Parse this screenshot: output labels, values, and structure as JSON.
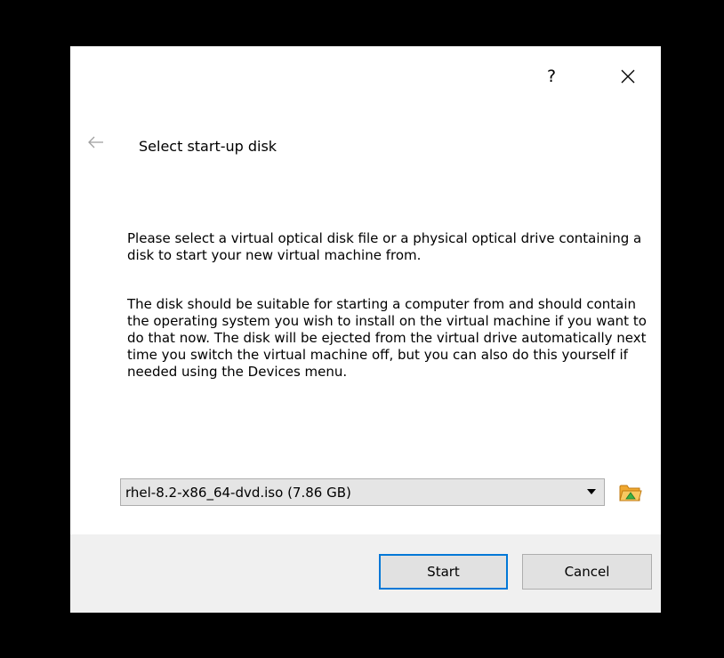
{
  "dialog": {
    "help_label": "?",
    "page_title": "Select start-up disk",
    "description_1": "Please select a virtual optical disk file or a physical optical drive containing a disk to start your new virtual machine from.",
    "description_2": "The disk should be suitable for starting a computer from and should contain the operating system you wish to install on the virtual machine if you want to do that now. The disk will be ejected from the virtual drive automatically next time you switch the virtual machine off, but you can also do this yourself if needed using the Devices menu.",
    "disk_select": {
      "selected": "rhel-8.2-x86_64-dvd.iso (7.86 GB)"
    },
    "buttons": {
      "start": "Start",
      "cancel": "Cancel"
    }
  },
  "colors": {
    "accent": "#0078d7",
    "footer_bg": "#f0f0f0",
    "combo_bg": "#e5e5e5"
  },
  "icons": [
    "close-icon",
    "back-arrow-icon",
    "chevron-down-icon",
    "folder-open-icon"
  ]
}
